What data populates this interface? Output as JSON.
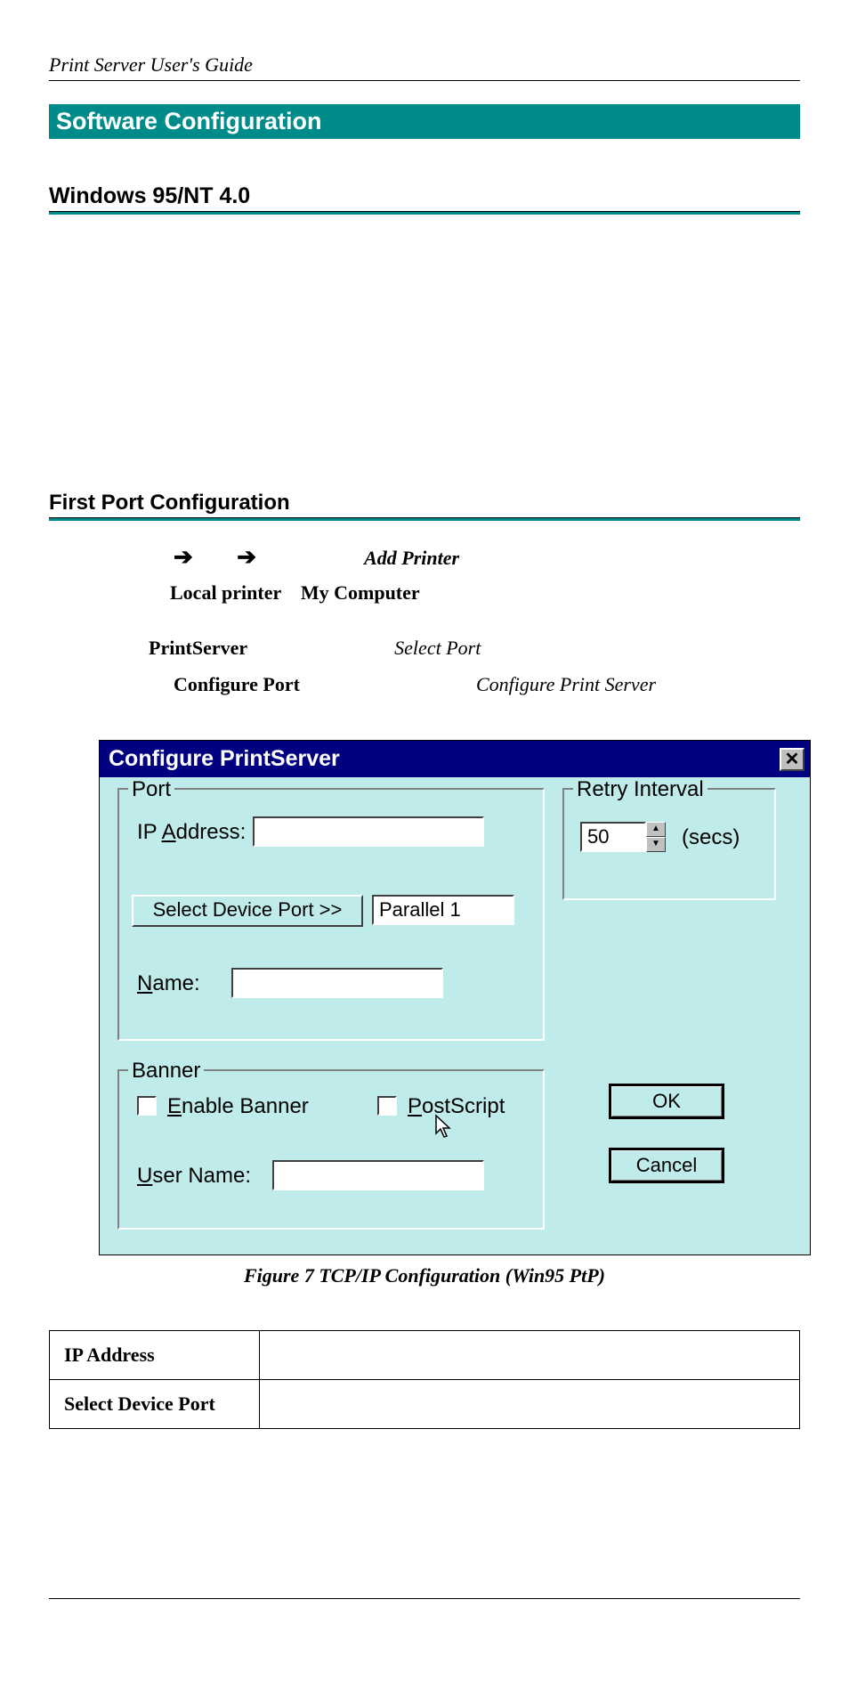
{
  "header": {
    "guide_title": "Print Server User's Guide"
  },
  "section": {
    "title": "Software Configuration",
    "subsection": "Windows 95/NT 4.0",
    "subsubsection": "First Port Configuration"
  },
  "nav": {
    "arrow": "➔",
    "add_printer": "Add Printer",
    "local_printer": "Local printer",
    "my_computer": "My Computer",
    "print_server": "PrintServer",
    "select_port": "Select Port",
    "configure_port": "Configure Port",
    "configure_print_server": "Configure Print Server"
  },
  "dialog": {
    "title": "Configure PrintServer",
    "close": "✕",
    "port_group": "Port",
    "retry_group": "Retry Interval",
    "banner_group": "Banner",
    "ip_pre": "IP ",
    "ip_u": "A",
    "ip_post": "ddress:",
    "ip_value": "",
    "select_device_btn": "Select Device Port >>",
    "port_value": "Parallel 1",
    "name_u": "N",
    "name_post": "ame:",
    "name_value": "",
    "retry_value": "50",
    "secs": "(secs)",
    "enable_u": "E",
    "enable_post": "nable Banner",
    "postscript_u": "P",
    "postscript_post": "ostScript",
    "username_u": "U",
    "username_post": "ser Name:",
    "username_value": "",
    "ok": "OK",
    "cancel": "Cancel"
  },
  "figure": {
    "caption": "Figure 7 TCP/IP Configuration (Win95 PtP)"
  },
  "table": {
    "rows": [
      {
        "label": "IP Address",
        "value": ""
      },
      {
        "label": "Select Device Port",
        "value": ""
      }
    ]
  }
}
